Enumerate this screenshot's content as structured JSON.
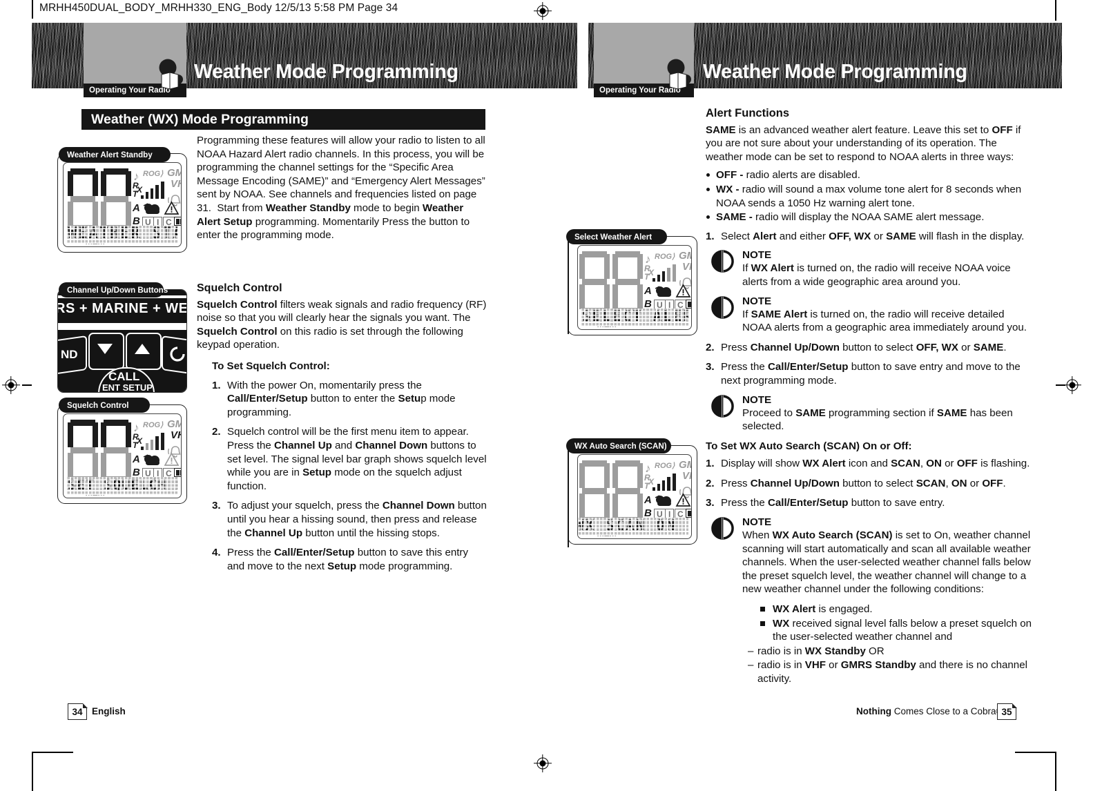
{
  "scan_header": "MRHH450DUAL_BODY_MRHH330_ENG_Body  12/5/13  5:58 PM  Page 34",
  "left_page": {
    "header_title": "Weather Mode Programming",
    "badge_label": "Operating Your Radio",
    "section_bar": "Weather (WX) Mode Programming",
    "intro_lines": [
      "Programming these features will allow your radio to listen to",
      "all NOAA Hazard Alert radio channels. In this process, you",
      "will be programming the channel settings for the “Specific",
      "Area Message Encoding (SAME)” and “Emergency Alert",
      "Messages” sent by NOAA. See channels and frequencies",
      "listed on page 31.  Start from ",
      " mode to begin",
      " programming. Momentarily Press the",
      "button to enter the programming mode."
    ],
    "intro_bold_1": "Weather Standby",
    "intro_bold_2": "Weather Alert Setup",
    "squelch_heading": "Squelch Control",
    "squelch_body": {
      "b1": "Squelch Control",
      "t1": " filters weak signals and radio frequency (RF)",
      "t2": "noise so that you will clearly hear the signals you want.",
      "t3": "The ",
      "b2": "Squelch Control",
      "t4": " on this radio is set through the following",
      "t5": "keypad operation."
    },
    "to_set_heading": "To Set Squelch Control:",
    "steps": [
      {
        "n": "1.",
        "parts": [
          {
            "t": "With the power On, momentarily press the ",
            "b": false
          },
          {
            "t": "Call/Enter/Setup",
            "b": true
          },
          {
            "t": " button to enter the ",
            "b": false
          },
          {
            "t": "Setu",
            "b": true
          },
          {
            "t": "p mode programming.",
            "b": false
          }
        ]
      },
      {
        "n": "2.",
        "parts": [
          {
            "t": "Squelch control will be the first menu item to appear. Press the ",
            "b": false
          },
          {
            "t": "Channel Up",
            "b": true
          },
          {
            "t": " and ",
            "b": false
          },
          {
            "t": "Channel Down",
            "b": true
          },
          {
            "t": " buttons to set level. The signal level bar graph shows squelch level while you are in ",
            "b": false
          },
          {
            "t": "Setup",
            "b": true
          },
          {
            "t": " mode on the squelch adjust function.",
            "b": false
          }
        ]
      },
      {
        "n": "3.",
        "parts": [
          {
            "t": "To adjust your squelch, press the ",
            "b": false
          },
          {
            "t": "Channel Down",
            "b": true
          },
          {
            "t": " button until you hear a hissing sound, then press and release the ",
            "b": false
          },
          {
            "t": "Channel Up",
            "b": true
          },
          {
            "t": " button until the hissing stops.",
            "b": false
          }
        ]
      },
      {
        "n": "4.",
        "parts": [
          {
            "t": "Press the ",
            "b": false
          },
          {
            "t": "Call/Enter/Setup",
            "b": true
          },
          {
            "t": " button to save this entry and move to the next ",
            "b": false
          },
          {
            "t": "Setup",
            "b": true
          },
          {
            "t": " mode programming.",
            "b": false
          }
        ]
      }
    ],
    "callouts": {
      "weather_alert_standby": "Weather Alert Standby",
      "channel_buttons": "Channel Up/Down Buttons",
      "squelch_control": "Squelch Control"
    },
    "lcd_standby_text": "WEATHER STANDBY",
    "lcd_squelch_text": "SET SQUELCH LEVEL",
    "keypad": {
      "band_text": "RS + MARINE + WEATH",
      "left_btn": "ND",
      "call": "CALL",
      "ent_setup": "ENT SETUP"
    },
    "footer_page": "34",
    "footer_label": "English"
  },
  "right_page": {
    "header_title": "Weather Mode Programming",
    "badge_label": "Operating Your Radio",
    "alert_heading": "Alert Functions",
    "alert_intro": {
      "b1": "SAME",
      "t1": " is an advanced weather alert feature. Leave this set to",
      "b2": "OFF",
      "t2": " if you are not sure about your understanding of its operation.",
      "t3": "The weather mode can be set to respond to NOAA alerts in three ways:"
    },
    "alert_bullets": [
      {
        "label": "OFF -",
        "text": "radio alerts are disabled."
      },
      {
        "label": "WX -",
        "text": "radio will sound a max volume tone alert for 8 seconds when NOAA sends a 1050 Hz warning alert tone."
      },
      {
        "label": "SAME -",
        "text": "radio will display the NOAA SAME alert message."
      }
    ],
    "steps_alert": [
      {
        "n": "1.",
        "parts": [
          {
            "t": "Select ",
            "b": false
          },
          {
            "t": "Alert",
            "b": true
          },
          {
            "t": " and either ",
            "b": false
          },
          {
            "t": "OFF, WX",
            "b": true
          },
          {
            "t": " or ",
            "b": false
          },
          {
            "t": "SAME",
            "b": true
          },
          {
            "t": " will flash in the display.",
            "b": false
          }
        ]
      }
    ],
    "note1": {
      "title": "NOTE",
      "parts": [
        {
          "t": "If ",
          "b": false
        },
        {
          "t": "WX Alert",
          "b": true
        },
        {
          "t": " is turned on, the radio will receive NOAA voice alerts from a wide geographic area around you.",
          "b": false
        }
      ]
    },
    "note2": {
      "title": "NOTE",
      "parts": [
        {
          "t": "If ",
          "b": false
        },
        {
          "t": "SAME Alert",
          "b": true
        },
        {
          "t": " is turned on, the radio will receive detailed NOAA alerts from a geographic area immediately around you.",
          "b": false
        }
      ]
    },
    "step2": {
      "n": "2.",
      "parts": [
        {
          "t": "Press ",
          "b": false
        },
        {
          "t": "Channel Up/Down",
          "b": true
        },
        {
          "t": " button to select ",
          "b": false
        },
        {
          "t": "OFF, WX",
          "b": true
        },
        {
          "t": " or ",
          "b": false
        },
        {
          "t": "SAME",
          "b": true
        },
        {
          "t": ".",
          "b": false
        }
      ]
    },
    "step3": {
      "n": "3.",
      "parts": [
        {
          "t": "Press the ",
          "b": false
        },
        {
          "t": "Call/Enter/Setup",
          "b": true
        },
        {
          "t": " button to save entry and move to the next programming mode.",
          "b": false
        }
      ]
    },
    "note3": {
      "title": "NOTE",
      "parts": [
        {
          "t": "Proceed to ",
          "b": false
        },
        {
          "t": "SAME",
          "b": true
        },
        {
          "t": " programming section if ",
          "b": false
        },
        {
          "t": "SAME",
          "b": true
        },
        {
          "t": " has been selected.",
          "b": false
        }
      ]
    },
    "scan_heading": "To Set WX Auto Search (SCAN) On or Off:",
    "scan_steps": [
      {
        "n": "1.",
        "parts": [
          {
            "t": "Display will show ",
            "b": false
          },
          {
            "t": "WX Alert",
            "b": true
          },
          {
            "t": " icon and ",
            "b": false
          },
          {
            "t": "SCAN",
            "b": true
          },
          {
            "t": ", ",
            "b": false
          },
          {
            "t": "ON",
            "b": true
          },
          {
            "t": " or ",
            "b": false
          },
          {
            "t": "OFF",
            "b": true
          },
          {
            "t": " is flashing.",
            "b": false
          }
        ]
      },
      {
        "n": "2.",
        "parts": [
          {
            "t": "Press ",
            "b": false
          },
          {
            "t": "Channel Up/Down",
            "b": true
          },
          {
            "t": " button to select ",
            "b": false
          },
          {
            "t": "SCAN",
            "b": true
          },
          {
            "t": ", ",
            "b": false
          },
          {
            "t": "ON",
            "b": true
          },
          {
            "t": " or ",
            "b": false
          },
          {
            "t": "OFF",
            "b": true
          },
          {
            "t": ".",
            "b": false
          }
        ]
      },
      {
        "n": "3.",
        "parts": [
          {
            "t": "Press the ",
            "b": false
          },
          {
            "t": "Call/Enter/Setup",
            "b": true
          },
          {
            "t": " button to save entry.",
            "b": false
          }
        ]
      }
    ],
    "note4": {
      "title": "NOTE",
      "parts": [
        {
          "t": "When ",
          "b": false
        },
        {
          "t": "WX Auto Search (SCAN)",
          "b": true
        },
        {
          "t": " is set to On, weather channel scanning will start automatically and scan all available weather channels. When the user-selected weather channel falls below the preset squelch level, the weather channel will change to a new weather channel under the following conditions:",
          "b": false
        }
      ]
    },
    "conditions": [
      {
        "type": "square",
        "parts": [
          {
            "t": "WX Alert",
            "b": true
          },
          {
            "t": " is engaged.",
            "b": false
          }
        ]
      },
      {
        "type": "square",
        "parts": [
          {
            "t": "WX",
            "b": true
          },
          {
            "t": " received signal level falls below a preset squelch on the user-selected weather channel and",
            "b": false
          }
        ]
      },
      {
        "type": "dash",
        "parts": [
          {
            "t": "radio is in ",
            "b": false
          },
          {
            "t": "WX Standby",
            "b": true
          },
          {
            "t": " OR",
            "b": false
          }
        ]
      },
      {
        "type": "dash",
        "parts": [
          {
            "t": "radio is in ",
            "b": false
          },
          {
            "t": "VHF",
            "b": true
          },
          {
            "t": " or ",
            "b": false
          },
          {
            "t": "GMRS Standby",
            "b": true
          },
          {
            "t": " and there is no channel activity.",
            "b": false
          }
        ]
      }
    ],
    "callouts": {
      "select_weather_alert": "Select Weather Alert",
      "wx_auto_search": "WX Auto Search (SCAN)"
    },
    "lcd_select_text": "SELECT ALERT WX",
    "lcd_scan_text": "WX SCAN ON",
    "footer_page": "35",
    "footer_bold": "Nothing",
    "footer_rest": " Comes Close to a Cobra®"
  },
  "lcd_icons": {
    "gmrs": "GMRS",
    "vhf": "VHF",
    "rog": "ROG⟩",
    "rx": "R",
    "tx": "T",
    "x": "X",
    "a": "A",
    "b": "B",
    "u": "U",
    "i": "I",
    "c": "C",
    "status_row": "VOX LOMEDHI SAME MEM"
  },
  "colors": {
    "ink": "#111111",
    "bar": "#161616",
    "band_grey": "#a8a8a8",
    "lcd_grey": "#9d9d9d",
    "matrix_bg": "#bdbdbd"
  }
}
